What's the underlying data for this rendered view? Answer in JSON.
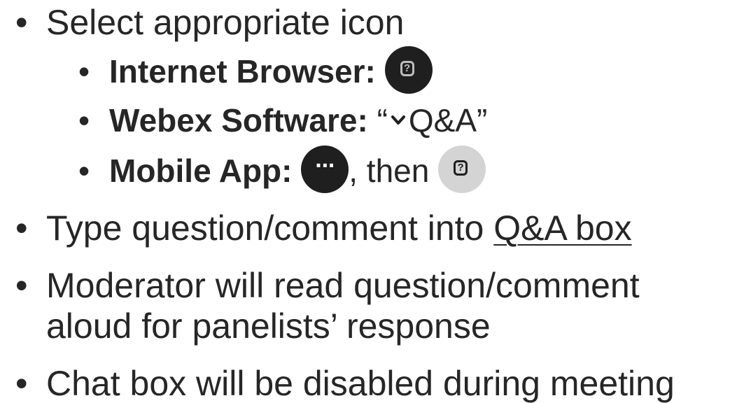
{
  "bullets": {
    "b1": "Select appropriate icon",
    "sub1_label": "Internet Browser:",
    "sub2_label": "Webex Software:",
    "sub2_open_quote": "“",
    "sub2_text": "Q&A”",
    "sub3_label": "Mobile App:",
    "sub3_then": ", then",
    "b2_prefix": "Type question/comment into ",
    "b2_link": "Q&A box",
    "b3_line1": "Moderator will read question/comment",
    "b3_line2": "aloud for panelists’ response",
    "b4": "Chat box will be disabled during meeting"
  },
  "icons": {
    "browser_qa": "question-box-icon",
    "webex_chevron": "chevron-down-icon",
    "mobile_more": "more-dots-icon",
    "mobile_qa": "question-box-icon"
  },
  "colors": {
    "text": "#262626",
    "icon_dark": "#1f1f1f",
    "icon_light": "#d4d4d4"
  },
  "glyphs": {
    "bullet": "•",
    "question": "?",
    "dots": "···"
  }
}
